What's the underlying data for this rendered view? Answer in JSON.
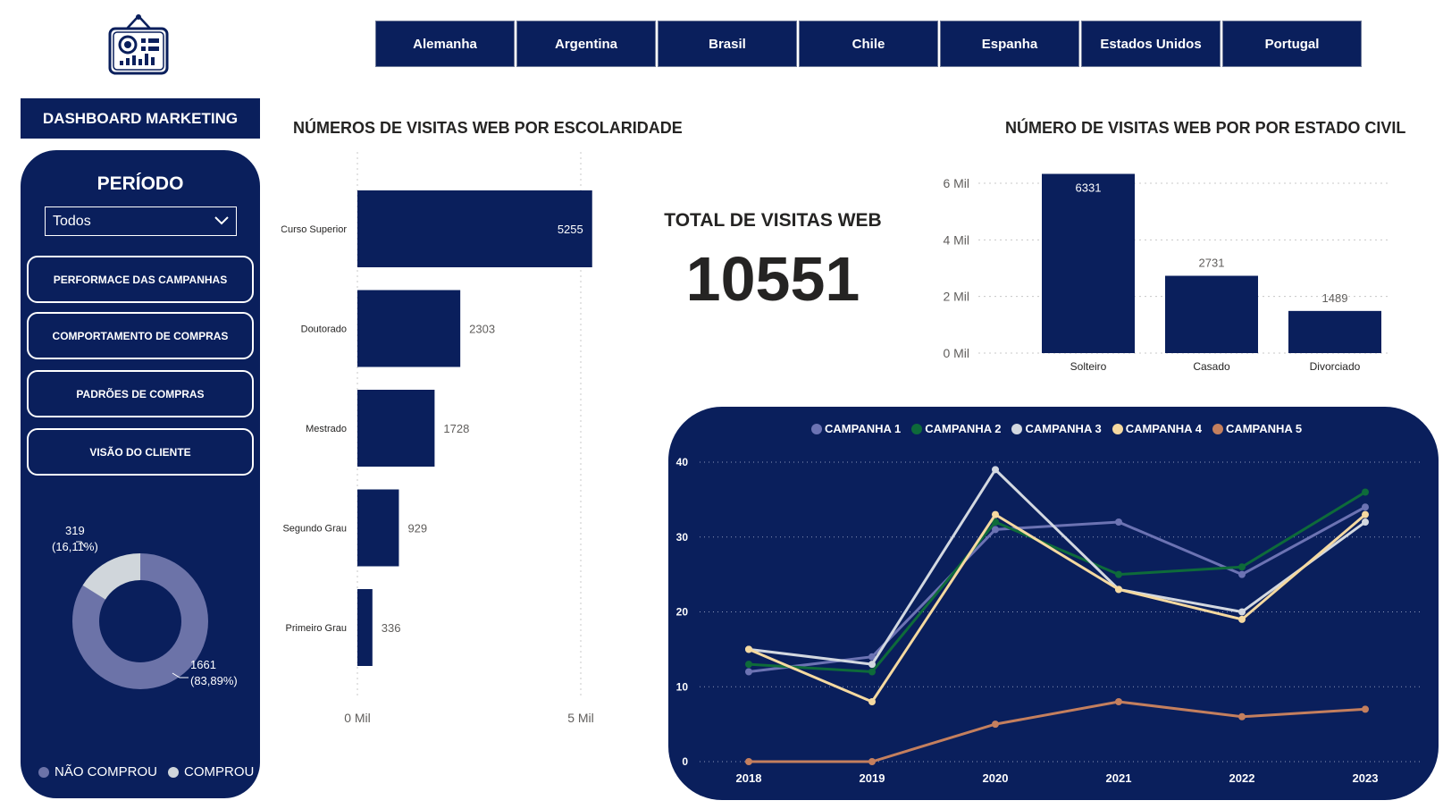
{
  "logo": {
    "icon": "dashboard-board-icon"
  },
  "countries": [
    "Alemanha",
    "Argentina",
    "Brasil",
    "Chile",
    "Espanha",
    "Estados Unidos",
    "Portugal"
  ],
  "sidebar": {
    "title": "DASHBOARD MARKETING",
    "period_label": "PERÍODO",
    "period_value": "Todos",
    "buttons": [
      "PERFORMACE DAS CAMPANHAS",
      "COMPORTAMENTO DE COMPRAS",
      "PADRÕES DE COMPRAS",
      "VISÃO DO CLIENTE"
    ],
    "legend": {
      "nao_comprou": "NÃO COMPROU",
      "comprou": "COMPROU"
    },
    "donut_labels": {
      "comprou_value": "319",
      "comprou_pct": "(16,11%)",
      "nao_comprou_value": "1661",
      "nao_comprou_pct": "(83,89%)"
    }
  },
  "charts_titles": {
    "education": "NÚMEROS DE VISITAS WEB POR ESCOLARIDADE",
    "civil": "NÚMERO DE VISITAS WEB POR POR ESTADO CIVIL"
  },
  "kpi": {
    "title": "TOTAL DE VISITAS WEB",
    "value": "10551"
  },
  "colors": {
    "navy": "#0a1f5c",
    "nao_comprou": "#6c73a8",
    "comprou": "#d0d6db",
    "campanha1": "#6c73b3",
    "campanha2": "#0e6b3a",
    "campanha3": "#d3d8e0",
    "campanha4": "#f5d9a0",
    "campanha5": "#c47f5e"
  },
  "chart_data": [
    {
      "type": "bar",
      "orientation": "horizontal",
      "categories": [
        "Curso Superior",
        "Doutorado",
        "Mestrado",
        "Segundo Grau",
        "Primeiro Grau"
      ],
      "values": [
        5255,
        2303,
        1728,
        929,
        336
      ],
      "xticks": [
        "0 Mil",
        "5 Mil"
      ],
      "xlim": [
        0,
        5000
      ]
    },
    {
      "type": "bar",
      "categories": [
        "Solteiro",
        "Casado",
        "Divorciado"
      ],
      "values": [
        6331,
        2731,
        1489
      ],
      "yticks": [
        "0 Mil",
        "2 Mil",
        "4 Mil",
        "6 Mil"
      ],
      "ylim": [
        0,
        6000
      ]
    },
    {
      "type": "line",
      "x": [
        "2018",
        "2019",
        "2020",
        "2021",
        "2022",
        "2023"
      ],
      "yticks": [
        "0",
        "10",
        "20",
        "30",
        "40"
      ],
      "ylim": [
        0,
        40
      ],
      "legend_position": "top",
      "series": [
        {
          "name": "CAMPANHA 1",
          "values": [
            12,
            14,
            31,
            32,
            25,
            34
          ]
        },
        {
          "name": "CAMPANHA 2",
          "values": [
            13,
            12,
            32,
            25,
            26,
            36
          ]
        },
        {
          "name": "CAMPANHA 3",
          "values": [
            15,
            13,
            39,
            23,
            20,
            32
          ]
        },
        {
          "name": "CAMPANHA 4",
          "values": [
            15,
            8,
            33,
            23,
            19,
            33
          ]
        },
        {
          "name": "CAMPANHA 5",
          "values": [
            0,
            0,
            5,
            8,
            6,
            7
          ]
        }
      ]
    },
    {
      "type": "pie",
      "variant": "donut",
      "categories": [
        "NÃO COMPROU",
        "COMPROU"
      ],
      "values": [
        1661,
        319
      ],
      "percent": [
        83.89,
        16.11
      ]
    }
  ]
}
